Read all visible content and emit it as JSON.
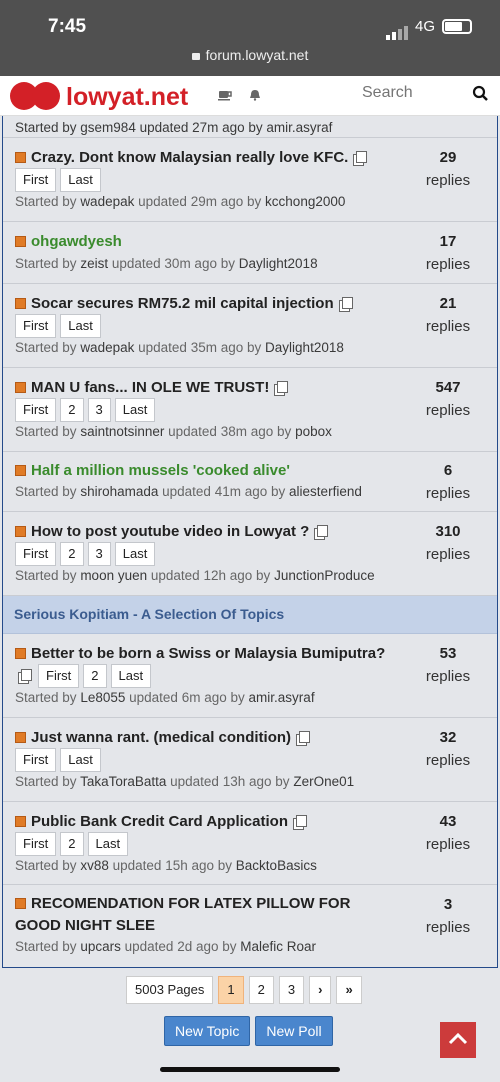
{
  "status": {
    "time": "7:45",
    "network": "4G",
    "url": "forum.lowyat.net"
  },
  "header": {
    "logo_text": "lowyat.net",
    "search_placeholder": "Search"
  },
  "top_partial": "Started by gsem984 updated 27m ago by amir.asyraf",
  "topics": [
    {
      "title": "Crazy. Dont know Malaysian really love KFC.",
      "pages": [
        "First",
        "Last"
      ],
      "started_by": "wadepak",
      "updated": "29m ago",
      "last_by": "kcchong2000",
      "replies": "29"
    },
    {
      "title": "ohgawdyesh",
      "pages": [],
      "started_by": "zeist",
      "updated": "30m ago",
      "last_by": "Daylight2018",
      "replies": "17"
    },
    {
      "title": "Socar secures RM75.2 mil capital injection",
      "pages": [
        "First",
        "Last"
      ],
      "started_by": "wadepak",
      "updated": "35m ago",
      "last_by": "Daylight2018",
      "replies": "21"
    },
    {
      "title": "MAN U fans... IN OLE WE TRUST!",
      "pages": [
        "First",
        "2",
        "3",
        "Last"
      ],
      "started_by": "saintnotsinner",
      "updated": "38m ago",
      "last_by": "pobox",
      "replies": "547"
    },
    {
      "title": "Half a million mussels 'cooked alive'",
      "pages": [],
      "started_by": "shirohamada",
      "updated": "41m ago",
      "last_by": "aliesterfiend",
      "replies": "6"
    },
    {
      "title": "How to post youtube video in Lowyat ?",
      "pages": [
        "First",
        "2",
        "3",
        "Last"
      ],
      "started_by": "moon yuen",
      "updated": "12h ago",
      "last_by": "JunctionProduce",
      "replies": "310"
    }
  ],
  "section_title": "Serious Kopitiam - A Selection Of Topics",
  "serious_topics": [
    {
      "title": "Better to be born a Swiss or Malaysia Bumiputra?",
      "pages": [
        "First",
        "2",
        "Last"
      ],
      "started_by": "Le8055",
      "updated": "6m ago",
      "last_by": "amir.asyraf",
      "replies": "53"
    },
    {
      "title": "Just wanna rant. (medical condition)",
      "pages": [
        "First",
        "Last"
      ],
      "started_by": "TakaToraBatta",
      "updated": "13h ago",
      "last_by": "ZerOne01",
      "replies": "32"
    },
    {
      "title": "Public Bank Credit Card Application",
      "pages": [
        "First",
        "2",
        "Last"
      ],
      "started_by": "xv88",
      "updated": "15h ago",
      "last_by": "BacktoBasics",
      "replies": "43"
    },
    {
      "title": "RECOMENDATION FOR LATEX PILLOW FOR GOOD NIGHT SLEE",
      "pages": [],
      "started_by": "upcars",
      "updated": "2d ago",
      "last_by": "Malefic Roar",
      "replies": "3"
    }
  ],
  "labels": {
    "started_by": "Started by",
    "updated": "updated",
    "by": "by",
    "replies": "replies"
  },
  "pagination": {
    "total": "5003 Pages",
    "pages": [
      "1",
      "2",
      "3"
    ],
    "next": "›",
    "last": "»"
  },
  "buttons": {
    "new_topic": "New Topic",
    "new_poll": "New Poll"
  }
}
